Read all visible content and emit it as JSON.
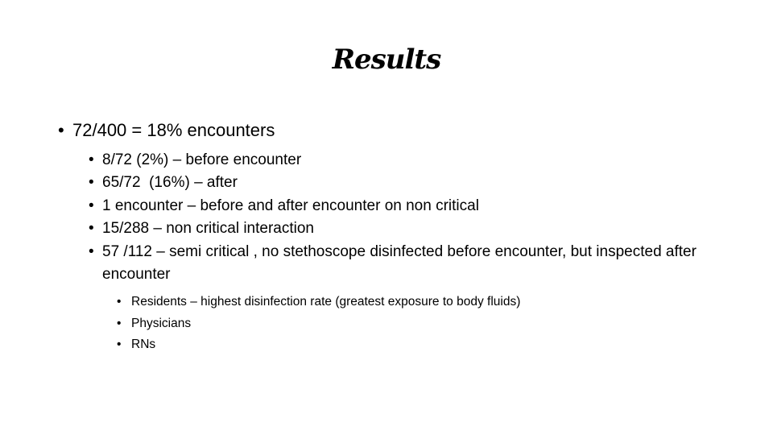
{
  "slide": {
    "title": "Results",
    "level1": [
      {
        "text": "72/400 = 18% encounters"
      }
    ],
    "level2": [
      {
        "text": "8/72 (2%) – before encounter"
      },
      {
        "text": "65/72  (16%) – after"
      },
      {
        "text": "1 encounter – before and after encounter on non critical"
      },
      {
        "text": "15/288 – non critical interaction"
      },
      {
        "text": "57 /112 – semi critical , no stethoscope disinfected before encounter, but inspected after encounter"
      }
    ],
    "level3": [
      {
        "text": "Residents – highest disinfection rate (greatest exposure to body fluids)"
      },
      {
        "text": "Physicians"
      },
      {
        "text": "RNs"
      }
    ],
    "bullet_glyph": "•"
  }
}
